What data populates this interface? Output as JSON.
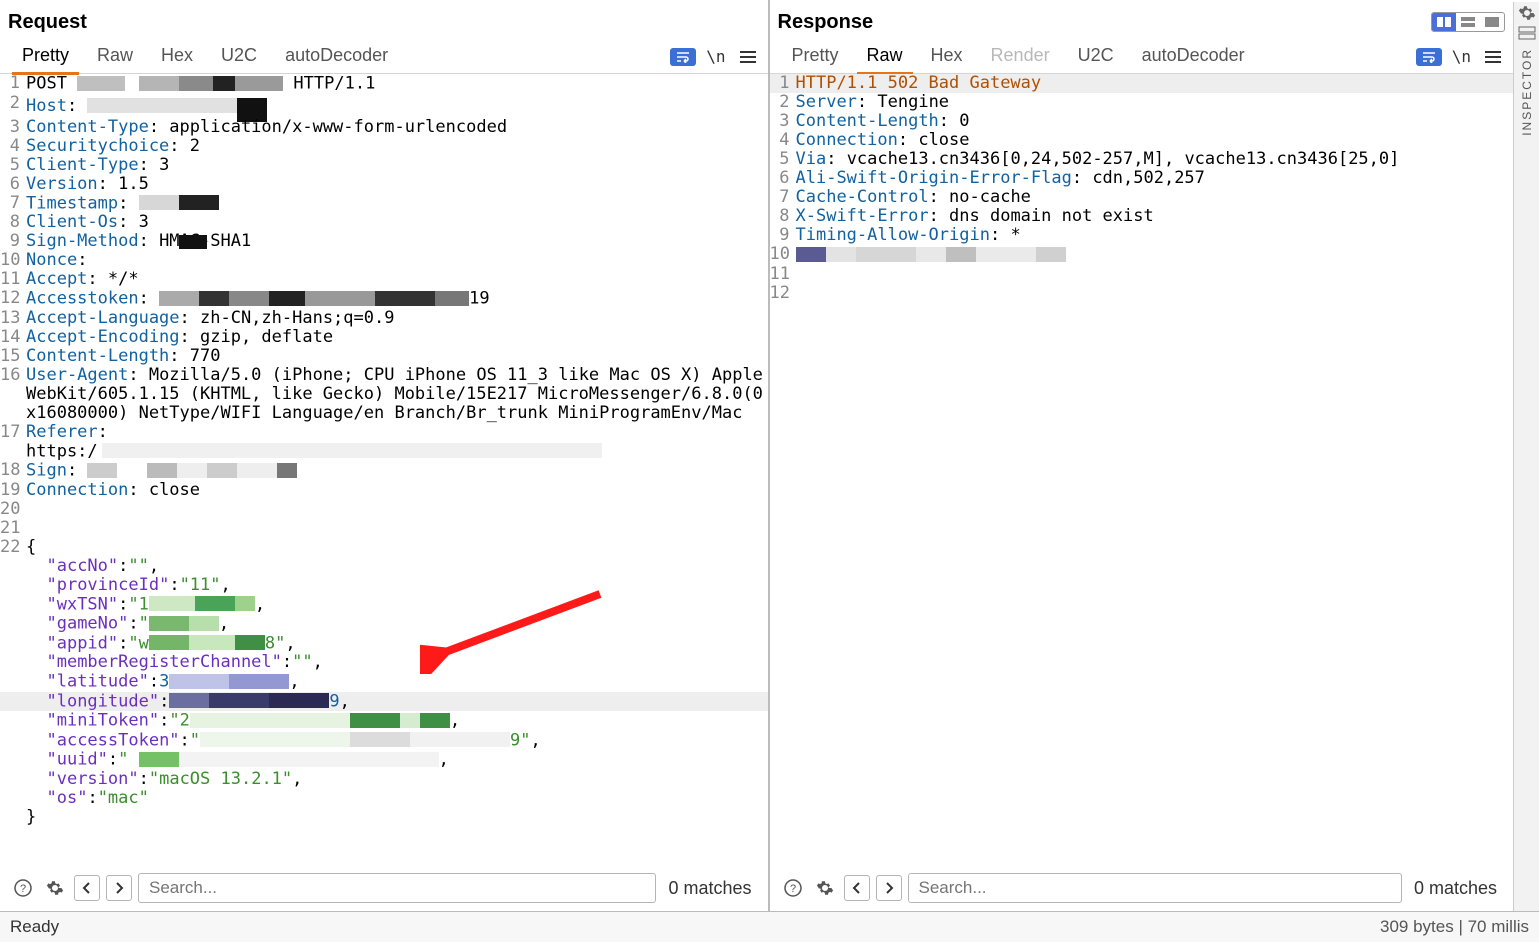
{
  "panes": {
    "request": {
      "title": "Request",
      "tabs": [
        "Pretty",
        "Raw",
        "Hex",
        "U2C",
        "autoDecoder"
      ],
      "activeTab": "Pretty",
      "matches": "0 matches",
      "searchPlaceholder": "Search...",
      "lines": {
        "l1_a": "POST ",
        "l1_b": " HTTP/1.1",
        "l2": "Host",
        "l3h": "Content-Type",
        "l3v": ": application/x-www-form-urlencoded",
        "l4h": "Securitychoice",
        "l4v": ": 2",
        "l5h": "Client-Type",
        "l5v": ": 3",
        "l6h": "Version",
        "l6v": ": 1.5",
        "l7h": "Timestamp",
        "l7v": ": ",
        "l8h": "Client-Os",
        "l8v": ": 3",
        "l9h": "Sign-Method",
        "l9v": ": HMAC-SHA1",
        "l10h": "Nonce",
        "l10v": ": ",
        "l11h": "Accept",
        "l11v": ": */*",
        "l12h": "Accesstoken",
        "l12v": ": ",
        "l12t": "19",
        "l13h": "Accept-Language",
        "l13v": ": zh-CN,zh-Hans;q=0.9",
        "l14h": "Accept-Encoding",
        "l14v": ": gzip, deflate",
        "l15h": "Content-Length",
        "l15v": ": 770",
        "l16h": "User-Agent",
        "l16v": ": Mozilla/5.0 (iPhone; CPU iPhone OS 11_3 like Mac OS X) AppleWebKit/605.1.15 (KHTML, like Gecko) Mobile/15E217 MicroMessenger/6.8.0(0x16080000) NetType/WIFI Language/en Branch/Br_trunk MiniProgramEnv/Mac",
        "l17h": "Referer",
        "l17v": ": https:/",
        "l18h": "Sign",
        "l18v": ": ",
        "l19h": "Connection",
        "l19v": ": close",
        "l22": "{",
        "j1k": "\"accNo\"",
        "j1v": "\"\"",
        "j2k": "\"provinceId\"",
        "j2v": "\"11\"",
        "j3k": "\"wxTSN\"",
        "j3v": "\"1",
        "j4k": "\"gameNo\"",
        "j4v": "\"",
        "j5k": "\"appid\"",
        "j5v": "\"w",
        "j5t": "8\"",
        "j6k": "\"memberRegisterChannel\"",
        "j6v": "\"\"",
        "j7k": "\"latitude\"",
        "j7v": "3",
        "j8k": "\"longitude\"",
        "j8v": "",
        "j8t": "9",
        "j9k": "\"miniToken\"",
        "j9v": "\"2",
        "j10k": "\"accessToken\"",
        "j10v": "\"",
        "j10t": "9\"",
        "j11k": "\"uuid\"",
        "j11v": "\" ",
        "j12k": "\"version\"",
        "j12v": "\"macOS 13.2.1\"",
        "j13k": "\"os\"",
        "j13v": "\"mac\"",
        "lend": "}"
      }
    },
    "response": {
      "title": "Response",
      "tabs": [
        "Pretty",
        "Raw",
        "Hex",
        "Render",
        "U2C",
        "autoDecoder"
      ],
      "activeTab": "Raw",
      "disabledTab": "Render",
      "matches": "0 matches",
      "searchPlaceholder": "Search...",
      "lines": {
        "r1": "HTTP/1.1 502 Bad Gateway",
        "r2h": "Server",
        "r2v": ": Tengine",
        "r3h": "Content-Length",
        "r3v": ": 0",
        "r4h": "Connection",
        "r4v": ": close",
        "r5h": "Via",
        "r5v": ": vcache13.cn3436[0,24,502-257,M], vcache13.cn3436[25,0]",
        "r6h": "Ali-Swift-Origin-Error-Flag",
        "r6v": ": cdn,502,257",
        "r7h": "Cache-Control",
        "r7v": ": no-cache",
        "r8h": "X-Swift-Error",
        "r8v": ": dns domain not exist",
        "r9h": "Timing-Allow-Origin",
        "r9v": ": *"
      }
    }
  },
  "status": {
    "left": "Ready",
    "right": "309 bytes | 70 millis"
  },
  "inspectorLabel": "INSPECTOR",
  "icons": {
    "wrap": "≡",
    "slashn": "\\n"
  }
}
